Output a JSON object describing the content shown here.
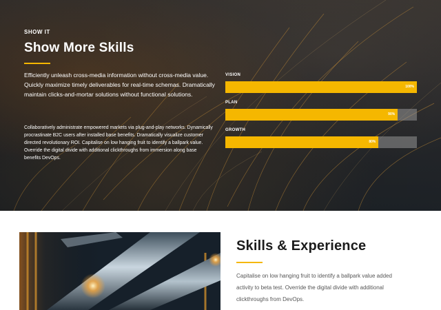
{
  "hero": {
    "eyebrow": "SHOW IT",
    "title": "Show More Skills",
    "lead": "Efficiently unleash cross-media information without cross-media value. Quickly maximize timely deliverables for real-time schemas. Dramatically maintain clicks-and-mortar solutions without functional solutions.",
    "body": "Collaboratively administrate empowered markets via plug-and-play networks. Dynamically procrastinate B2C users after installed base benefits. Dramatically visualize customer directed revolutionary ROI. Capitalise on low hanging fruit to identify a ballpark value. Override the digital divide with additional clickthroughs from immersion along base benefits DevOps."
  },
  "skills": [
    {
      "label": "VISION",
      "value": 100,
      "value_text": "100%"
    },
    {
      "label": "PLAN",
      "value": 90,
      "value_text": "90%"
    },
    {
      "label": "GROWTH",
      "value": 80,
      "value_text": "80%"
    }
  ],
  "section": {
    "title": "Skills & Experience",
    "text": "Capitalise on low hanging fruit to identify a ballpark value added activity to beta test. Override the digital divide with additional clickthroughs from DevOps."
  },
  "colors": {
    "accent": "#f5b700",
    "track": "#969696",
    "dark_text": "#1b1b1b"
  }
}
